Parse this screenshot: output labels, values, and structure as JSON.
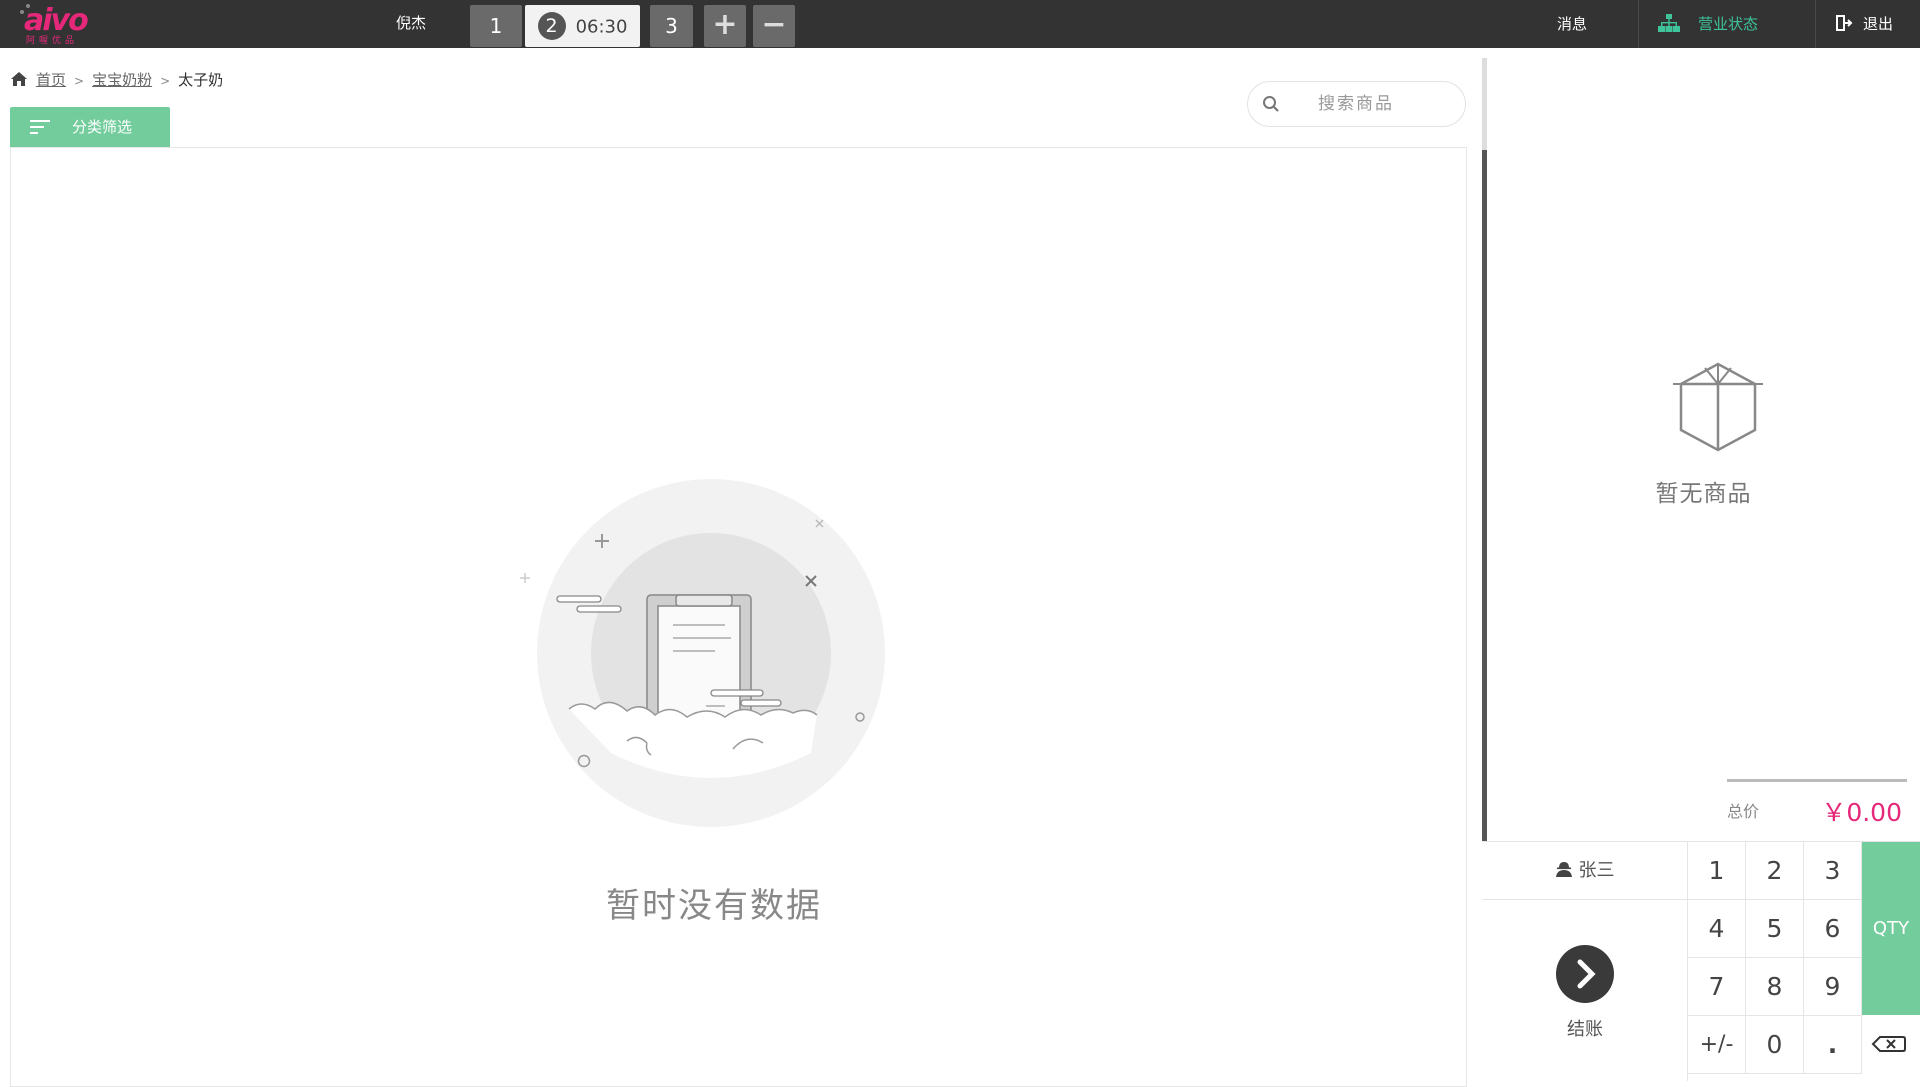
{
  "topbar": {
    "logo_text": "aivo",
    "logo_sub": "阿喔优品",
    "user_name": "倪杰",
    "tabs": [
      {
        "label": "1"
      },
      {
        "number": "2",
        "time": "06:30"
      },
      {
        "label": "3"
      }
    ],
    "add_tab": "+",
    "remove_tab": "−",
    "messages": "消息",
    "business_status": "营业状态",
    "logout": "退出"
  },
  "breadcrumb": {
    "home": "首页",
    "category": "宝宝奶粉",
    "current": "太子奶",
    "separator": ">"
  },
  "filter_button": "分类筛选",
  "search": {
    "placeholder": "搜索商品"
  },
  "empty_state": "暂时没有数据",
  "cart": {
    "empty_text": "暂无商品",
    "total_label": "总价",
    "total_value": "￥0.00"
  },
  "keypad": {
    "member_name": "张三",
    "checkout_label": "结账",
    "keys": [
      "1",
      "2",
      "3",
      "4",
      "5",
      "6",
      "7",
      "8",
      "9",
      "+/-",
      "0",
      "."
    ],
    "qty_label": "QTY"
  },
  "colors": {
    "accent": "#73cc9c",
    "brand_pink": "#e6287a",
    "topbar_bg": "#333333",
    "status_green": "#3ec39a"
  }
}
